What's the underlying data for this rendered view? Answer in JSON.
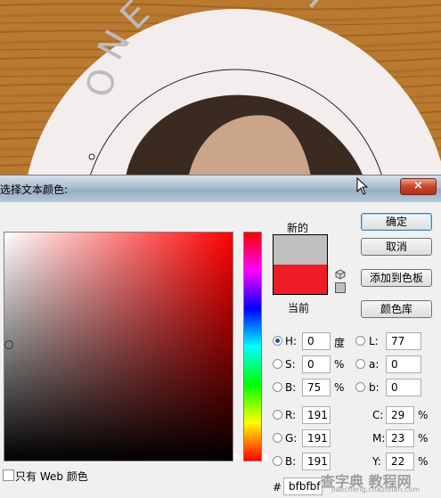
{
  "canvas": {
    "coaster_text": "ONE PENNY"
  },
  "dialog": {
    "title": "选择文本颜色:",
    "close_label": "×",
    "labels": {
      "new": "新的",
      "current": "当前"
    },
    "colors": {
      "new": "#bfbfbf",
      "current": "#ee1c24"
    },
    "buttons": {
      "ok": "确定",
      "cancel": "取消",
      "add_to_swatches": "添加到色板",
      "color_libraries": "颜色库"
    },
    "hsb": {
      "h_label": "H:",
      "h_value": "0",
      "h_unit": "度",
      "s_label": "S:",
      "s_value": "0",
      "s_unit": "%",
      "b_label": "B:",
      "b_value": "75",
      "b_unit": "%"
    },
    "lab": {
      "l_label": "L:",
      "l_value": "77",
      "a_label": "a:",
      "a_value": "0",
      "b_label": "b:",
      "b_value": "0"
    },
    "rgb": {
      "r_label": "R:",
      "r_value": "191",
      "g_label": "G:",
      "g_value": "191",
      "b_label": "B:",
      "b_value": "191"
    },
    "cmyk": {
      "c_label": "C:",
      "c_value": "29",
      "c_unit": "%",
      "m_label": "M:",
      "m_value": "23",
      "m_unit": "%",
      "y_label": "Y:",
      "y_value": "22",
      "y_unit": "%"
    },
    "hex": {
      "label": "#",
      "value": "bfbfbf"
    },
    "web_only_label": "只有 Web 颜色",
    "watermark": "查字典 教程网",
    "watermark_sub": "jiaocheng.chazidian.com"
  }
}
